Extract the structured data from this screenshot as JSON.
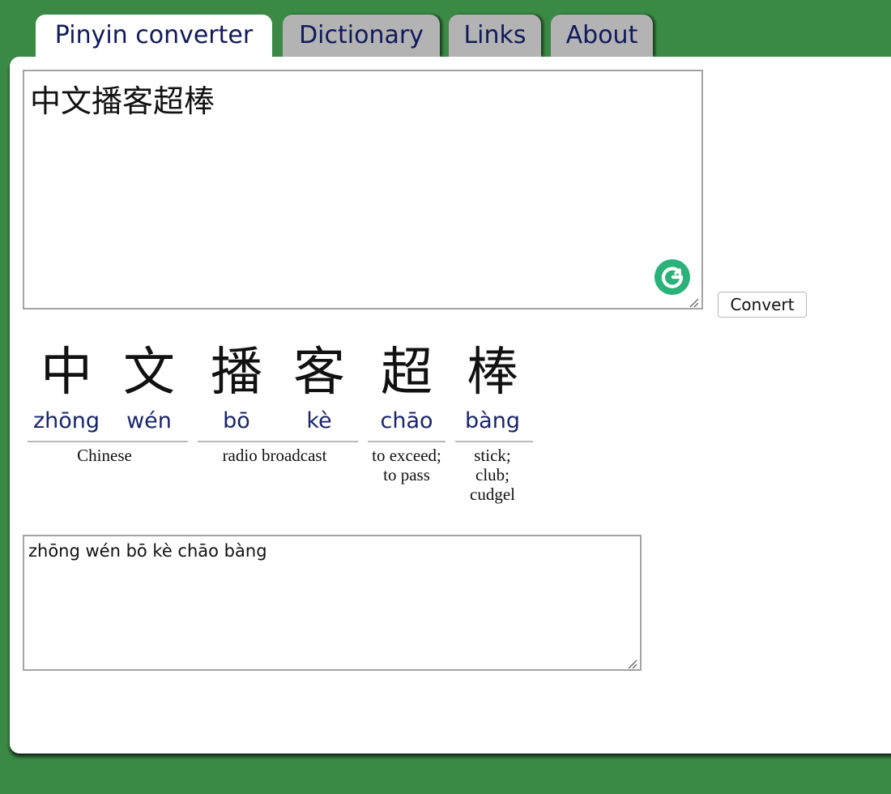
{
  "tabs": [
    {
      "label": "Pinyin converter",
      "active": true
    },
    {
      "label": "Dictionary",
      "active": false
    },
    {
      "label": "Links",
      "active": false
    },
    {
      "label": "About",
      "active": false
    }
  ],
  "input": {
    "value": "中文播客超棒"
  },
  "convert_label": "Convert",
  "words": [
    {
      "syllables": [
        {
          "hanzi": "中",
          "pinyin": "zhōng"
        },
        {
          "hanzi": "文",
          "pinyin": "wén"
        }
      ],
      "meaning": "Chinese"
    },
    {
      "syllables": [
        {
          "hanzi": "播",
          "pinyin": "bō"
        },
        {
          "hanzi": "客",
          "pinyin": "kè"
        }
      ],
      "meaning": "radio broadcast"
    },
    {
      "syllables": [
        {
          "hanzi": "超",
          "pinyin": "chāo"
        }
      ],
      "meaning_lines": [
        "to exceed;",
        "to pass"
      ]
    },
    {
      "syllables": [
        {
          "hanzi": "棒",
          "pinyin": "bàng"
        }
      ],
      "meaning_lines": [
        "stick;",
        "club;",
        "cudgel"
      ]
    }
  ],
  "output": {
    "value": "zhōng wén bō kè chāo bàng"
  },
  "colors": {
    "background": "#3a8a46",
    "pinyin_text": "#18256a",
    "grammarly": "#2bb27a"
  },
  "icons": {
    "assistant": "grammarly-icon",
    "resize": "resize-grip-icon"
  }
}
